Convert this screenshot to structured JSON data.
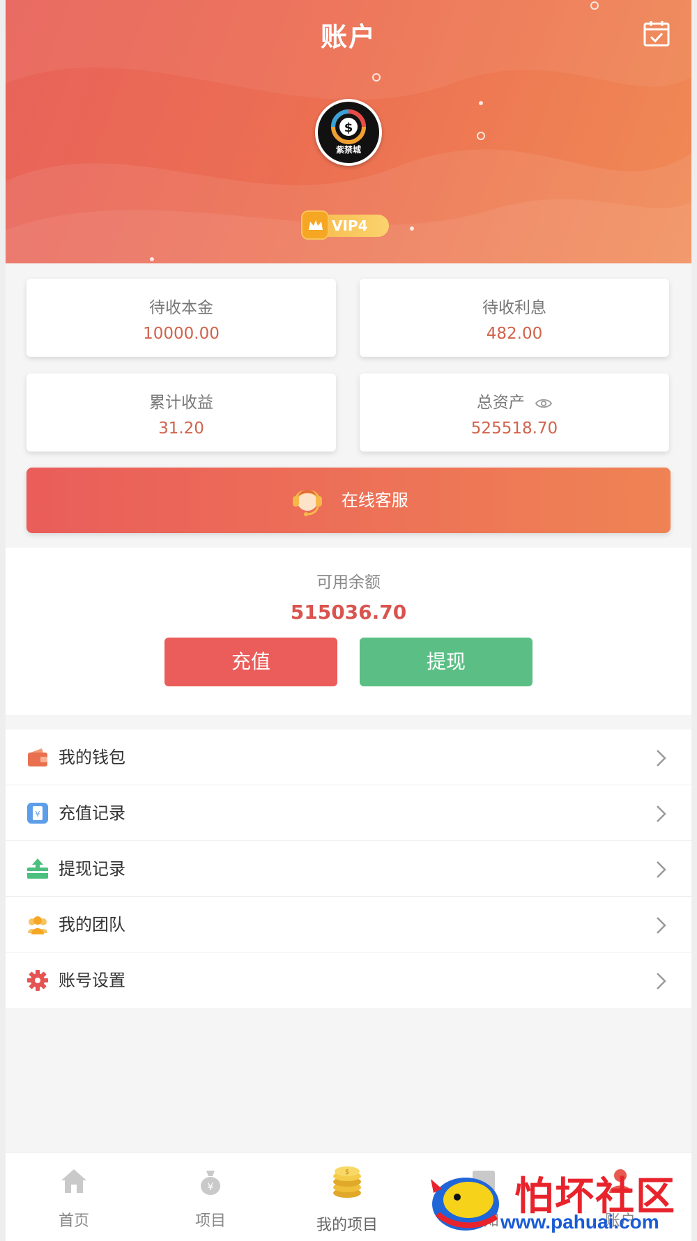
{
  "header": {
    "title": "账户",
    "avatar_text": "紫禁城",
    "vip_label": "VIP4"
  },
  "stats": {
    "pending_principal": {
      "label": "待收本金",
      "value": "10000.00"
    },
    "pending_interest": {
      "label": "待收利息",
      "value": "482.00"
    },
    "accumulated_income": {
      "label": "累计收益",
      "value": "31.20"
    },
    "total_assets": {
      "label": "总资产",
      "value": "525518.70"
    }
  },
  "service": {
    "label": "在线客服"
  },
  "balance": {
    "label": "可用余额",
    "value": "515036.70",
    "recharge_label": "充值",
    "withdraw_label": "提现"
  },
  "menu": {
    "items": [
      {
        "label": "我的钱包",
        "icon": "wallet-icon"
      },
      {
        "label": "充值记录",
        "icon": "recharge-record-icon"
      },
      {
        "label": "提现记录",
        "icon": "withdraw-record-icon"
      },
      {
        "label": "我的团队",
        "icon": "team-icon"
      },
      {
        "label": "账号设置",
        "icon": "settings-icon"
      }
    ]
  },
  "tabbar": {
    "items": [
      {
        "label": "首页",
        "icon": "home-icon"
      },
      {
        "label": "项目",
        "icon": "moneybag-icon"
      },
      {
        "label": "我的项目",
        "icon": "coins-icon"
      },
      {
        "label": "通知",
        "icon": "notice-icon"
      },
      {
        "label": "账户",
        "icon": "account-icon"
      }
    ]
  },
  "watermark": {
    "text": "怕坏社区",
    "url": "www.pahuai.com"
  },
  "colors": {
    "accent_red": "#ea5d5a",
    "accent_orange": "#ef8354",
    "value_red": "#d0634b",
    "withdraw_green": "#5bbf85",
    "vip_gold": "#f7b84a"
  }
}
